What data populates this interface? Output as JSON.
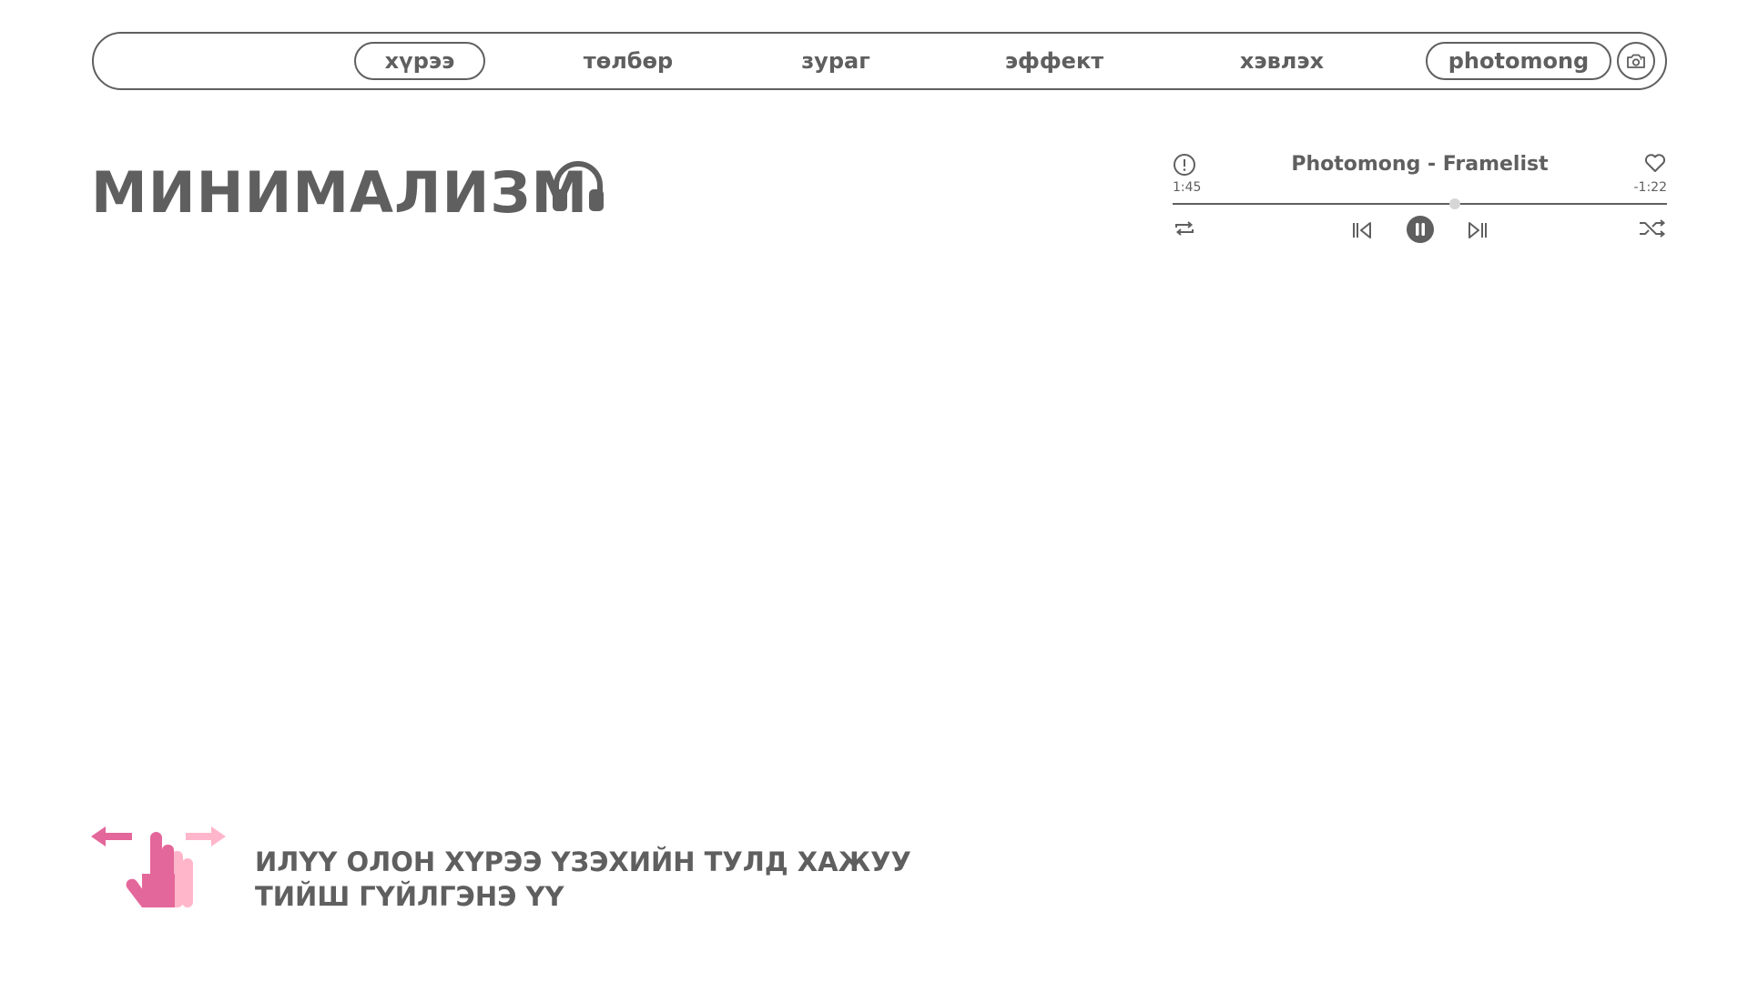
{
  "nav": {
    "items": [
      {
        "label": "хүрээ",
        "style": "pill"
      },
      {
        "label": "төлбөр",
        "style": "plain"
      },
      {
        "label": "зураг",
        "style": "plain"
      },
      {
        "label": "эффект",
        "style": "plain"
      },
      {
        "label": "хэвлэх",
        "style": "plain"
      },
      {
        "label": "photomong",
        "style": "pill"
      }
    ],
    "camera_icon": "camera-icon"
  },
  "page": {
    "title": "МИНИМАЛИЗМ",
    "title_icon": "headphones-icon"
  },
  "player": {
    "track_title": "Photomong - Framelist",
    "elapsed": "1:45",
    "remaining": "-1:22",
    "progress_fraction": 0.57,
    "icons": [
      "info-icon",
      "heart-icon",
      "repeat-icon",
      "skip-previous-icon",
      "pause-icon",
      "skip-next-icon",
      "shuffle-icon"
    ]
  },
  "hint": {
    "line1": "ИЛҮҮ ОЛОН ХҮРЭЭ ҮЗЭХИЙН ТУЛД ХАЖУУ",
    "line2": "ТИЙШ ГҮЙЛГЭНЭ ҮҮ",
    "icon": "swipe-hand-icon"
  },
  "colors": {
    "text": "#5f5f5f",
    "accent_pink": "#e4679b",
    "light_pink": "#ffb6cb",
    "thumb": "#d6d6d6",
    "background": "#ffffff"
  }
}
